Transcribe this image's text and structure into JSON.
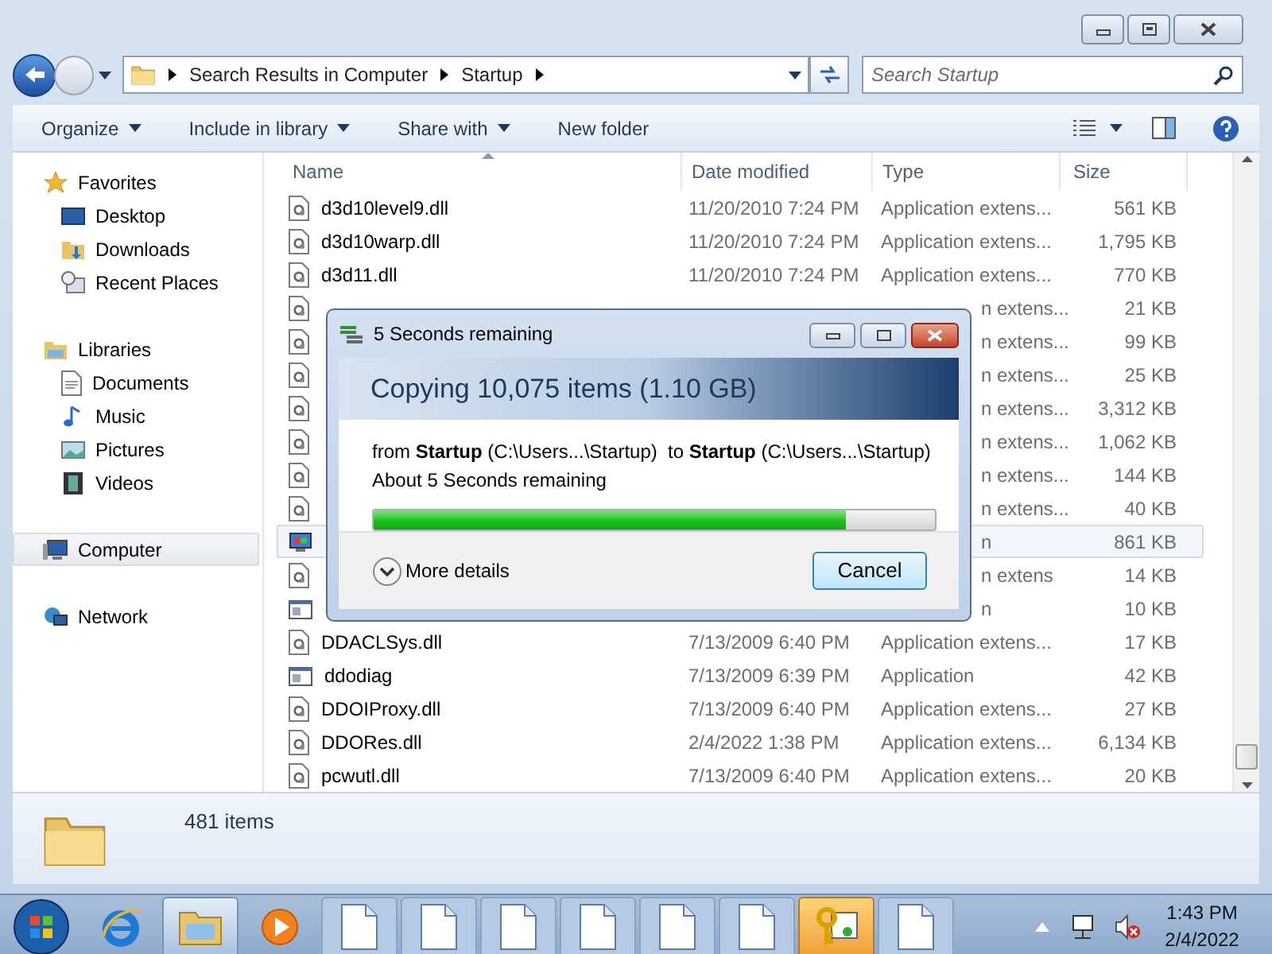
{
  "address": {
    "crumbs": [
      "Search Results in Computer",
      "Startup"
    ]
  },
  "search": {
    "placeholder": "Search Startup"
  },
  "toolbar": [
    {
      "label": "Organize",
      "menu": true
    },
    {
      "label": "Include in library",
      "menu": true
    },
    {
      "label": "Share with",
      "menu": true
    },
    {
      "label": "New folder",
      "menu": false
    }
  ],
  "sidebar": [
    {
      "label": "Favorites",
      "kind": "star",
      "selected": false,
      "children": [
        {
          "label": "Desktop",
          "kind": "desktop",
          "selected": false
        },
        {
          "label": "Downloads",
          "kind": "downloads",
          "selected": false
        },
        {
          "label": "Recent Places",
          "kind": "recent",
          "selected": false
        }
      ]
    },
    {
      "label": "Libraries",
      "kind": "libraries",
      "selected": false,
      "children": [
        {
          "label": "Documents",
          "kind": "documents",
          "selected": false
        },
        {
          "label": "Music",
          "kind": "music",
          "selected": false
        },
        {
          "label": "Pictures",
          "kind": "pictures",
          "selected": false
        },
        {
          "label": "Videos",
          "kind": "videos",
          "selected": false
        }
      ]
    },
    {
      "label": "Computer",
      "kind": "computer",
      "selected": true
    },
    {
      "label": "Network",
      "kind": "network",
      "selected": false
    }
  ],
  "table": {
    "columns": [
      "Name",
      "Date modified",
      "Type",
      "Size"
    ],
    "rows": [
      {
        "kind": "dll",
        "name": "d3d10level9.dll",
        "date": "11/20/2010 7:24 PM",
        "type": "Application extens...",
        "size": "561 KB",
        "selected": false
      },
      {
        "kind": "dll",
        "name": "d3d10warp.dll",
        "date": "11/20/2010 7:24 PM",
        "type": "Application extens...",
        "size": "1,795 KB",
        "selected": false
      },
      {
        "kind": "dll",
        "name": "d3d11.dll",
        "date": "11/20/2010 7:24 PM",
        "type": "Application extens...",
        "size": "770 KB",
        "selected": false
      },
      {
        "kind": "dll",
        "type": "n extens...",
        "size": "21 KB",
        "selected": false
      },
      {
        "kind": "dll",
        "type": "n extens...",
        "size": "99 KB",
        "selected": false
      },
      {
        "kind": "dll",
        "type": "n extens...",
        "size": "25 KB",
        "selected": false
      },
      {
        "kind": "dll",
        "type": "n extens...",
        "size": "3,312 KB",
        "selected": false
      },
      {
        "kind": "dll",
        "type": "n extens...",
        "size": "1,062 KB",
        "selected": false
      },
      {
        "kind": "dll",
        "type": "n extens...",
        "size": "144 KB",
        "selected": false
      },
      {
        "kind": "dll",
        "type": "n extens...",
        "size": "40 KB",
        "selected": false
      },
      {
        "kind": "display",
        "type": "n",
        "size": "861 KB",
        "selected": true
      },
      {
        "kind": "dll",
        "type": "n extens",
        "size": "14 KB",
        "selected": false
      },
      {
        "kind": "app",
        "type": "n",
        "size": "10 KB",
        "selected": false
      },
      {
        "kind": "dll",
        "name": "DDACLSys.dll",
        "date": "7/13/2009 6:40 PM",
        "type": "Application extens...",
        "size": "17 KB",
        "selected": false
      },
      {
        "kind": "app",
        "name": "ddodiag",
        "date": "7/13/2009 6:39 PM",
        "type": "Application",
        "size": "42 KB",
        "selected": false
      },
      {
        "kind": "dll",
        "name": "DDOIProxy.dll",
        "date": "7/13/2009 6:40 PM",
        "type": "Application extens...",
        "size": "27 KB",
        "selected": false
      },
      {
        "kind": "dll",
        "name": "DDORes.dll",
        "date": "2/4/2022 1:38 PM",
        "type": "Application extens...",
        "size": "6,134 KB",
        "selected": false
      },
      {
        "kind": "dll",
        "name": "pcwutl.dll",
        "date": "7/13/2009 6:40 PM",
        "type": "Application extens...",
        "size": "20 KB",
        "selected": false
      }
    ]
  },
  "details": {
    "count": "481 items"
  },
  "dialog": {
    "title": "5 Seconds remaining",
    "heading": "Copying 10,075 items (1.10 GB)",
    "route": "from **Startup** (C:\\Users...\\Startup)  to **Startup** (C:\\Users...\\Startup)",
    "remaining": "About 5 Seconds remaining",
    "level": 0.84,
    "more_details": "More details",
    "cancel": "Cancel"
  },
  "taskbar": {
    "apps": [
      {
        "kind": "ie",
        "active": false
      },
      {
        "kind": "explorer",
        "active": true
      },
      {
        "kind": "media",
        "active": false
      },
      {
        "kind": "doc",
        "active": false
      },
      {
        "kind": "doc",
        "active": false
      },
      {
        "kind": "doc",
        "active": false
      },
      {
        "kind": "doc",
        "active": false
      },
      {
        "kind": "doc",
        "active": false
      },
      {
        "kind": "doc",
        "active": false
      },
      {
        "kind": "keys",
        "active": true
      },
      {
        "kind": "doc",
        "active": false
      }
    ],
    "time": "1:43 PM",
    "date": "2/4/2022"
  }
}
